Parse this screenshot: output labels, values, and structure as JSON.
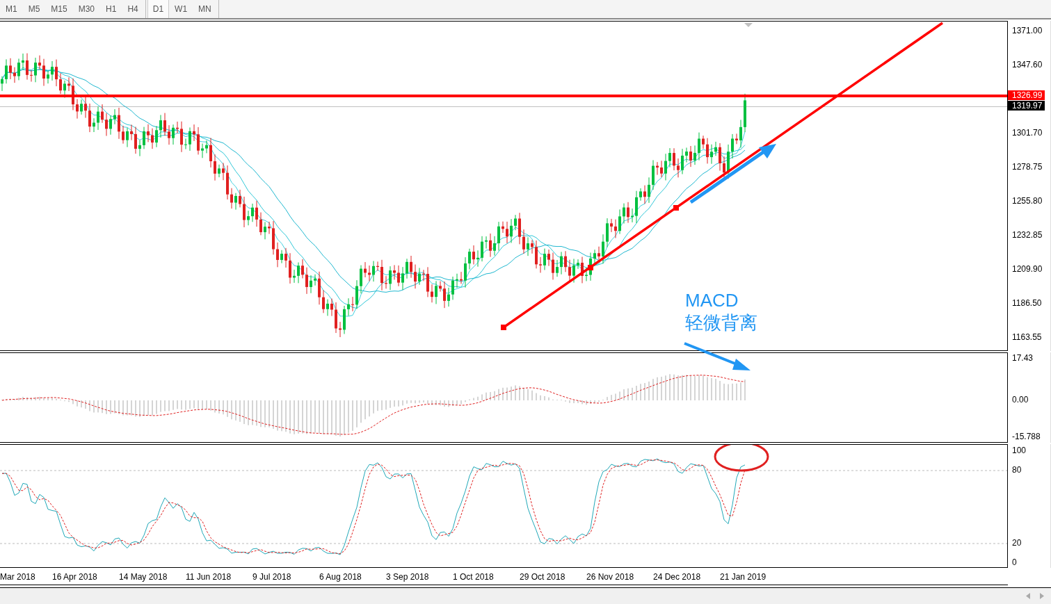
{
  "toolbar": {
    "timeframes": [
      {
        "label": "M1",
        "selected": false
      },
      {
        "label": "M5",
        "selected": false
      },
      {
        "label": "M15",
        "selected": false
      },
      {
        "label": "M30",
        "selected": false
      },
      {
        "label": "H1",
        "selected": false
      },
      {
        "label": "H4",
        "selected": false
      },
      {
        "label": "D1",
        "selected": true
      },
      {
        "label": "W1",
        "selected": false
      },
      {
        "label": "MN",
        "selected": false
      }
    ]
  },
  "main_pane": {
    "price_ticks": [
      "1371.00",
      "1347.60",
      "1301.70",
      "1278.75",
      "1255.80",
      "1232.85",
      "1209.90",
      "1186.50",
      "1163.55"
    ],
    "horizontal_line_label": "1326.99",
    "current_price_label": "1319.97",
    "annotation": {
      "title": "MACD",
      "subtitle": "轻微背离"
    }
  },
  "macd_pane": {
    "ticks": [
      "17.43",
      "0.00",
      "-15.788"
    ]
  },
  "stochastic_pane": {
    "ticks": [
      "100",
      "80",
      "20",
      "0"
    ]
  },
  "date_axis": {
    "labels": [
      "Mar 2018",
      "16 Apr 2018",
      "14 May 2018",
      "11 Jun 2018",
      "9 Jul 2018",
      "6 Aug 2018",
      "3 Sep 2018",
      "1 Oct 2018",
      "29 Oct 2018",
      "26 Nov 2018",
      "24 Dec 2018",
      "21 Jan 2019"
    ]
  }
}
